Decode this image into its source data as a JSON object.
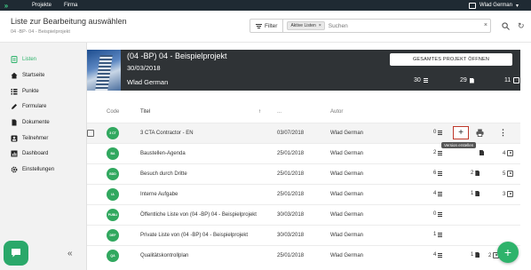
{
  "topbar": {
    "nav": [
      "Projekte",
      "Firma"
    ],
    "user": "Wlad German"
  },
  "header": {
    "title": "Liste zur Bearbeitung auswählen",
    "breadcrumb": "04 -BP- 04 - Beispielprojekt",
    "filter_label": "Filter",
    "chip_label": "Aktive Listen",
    "chip_close": "×",
    "search_placeholder": "Suchen",
    "search_clear": "×"
  },
  "sidebar": {
    "items": [
      {
        "label": "Listen",
        "icon": "list-icon"
      },
      {
        "label": "Startseite",
        "icon": "home-icon"
      },
      {
        "label": "Punkte",
        "icon": "points-icon"
      },
      {
        "label": "Formulare",
        "icon": "pencil-icon"
      },
      {
        "label": "Dokumente",
        "icon": "document-icon"
      },
      {
        "label": "Teilnehmer",
        "icon": "participant-icon"
      },
      {
        "label": "Dashboard",
        "icon": "dashboard-icon"
      },
      {
        "label": "Einstellungen",
        "icon": "gear-icon"
      }
    ],
    "collapse": "«"
  },
  "banner": {
    "name": "(04 -BP) 04 - Beispielprojekt",
    "date": "30/03/2018",
    "manager": "Wlad German",
    "open_button": "GESAMTES PROJEKT ÖFFNEN",
    "stats": {
      "lists": "30",
      "documents": "29",
      "participants": "11"
    }
  },
  "table": {
    "headers": {
      "code": "Code",
      "title": "Titel",
      "sort": "↑",
      "date": "...",
      "author": "Autor"
    },
    "rows": [
      {
        "code": "3 CT",
        "title": "3 CTA Contractor - EN",
        "date": "03/07/2018",
        "author": "Wlad German",
        "points": "0",
        "docs": "",
        "people": ""
      },
      {
        "code": "BA",
        "title": "Baustellen-Agenda",
        "date": "25/01/2018",
        "author": "Wlad German",
        "points": "2",
        "docs": "",
        "people": "4"
      },
      {
        "code": "BDD",
        "title": "Besuch durch Dritte",
        "date": "25/01/2018",
        "author": "Wlad German",
        "points": "6",
        "docs": "2",
        "people": "5"
      },
      {
        "code": "IA",
        "title": "Interne Aufgabe",
        "date": "25/01/2018",
        "author": "Wlad German",
        "points": "4",
        "docs": "1",
        "people": "3"
      },
      {
        "code": "PUBLI",
        "title": "Öffentliche Liste von (04 -BP) 04 - Beispielprojekt",
        "date": "30/03/2018",
        "author": "Wlad German",
        "points": "0",
        "docs": "",
        "people": ""
      },
      {
        "code": "DEF",
        "title": "Private Liste von (04 -BP) 04 - Beispielprojekt",
        "date": "30/03/2018",
        "author": "Wlad German",
        "points": "1",
        "docs": "",
        "people": ""
      },
      {
        "code": "QA",
        "title": "Qualitätskontrollplan",
        "date": "25/01/2018",
        "author": "Wlad German",
        "points": "4",
        "docs": "1",
        "people": "2"
      }
    ]
  },
  "row_actions": {
    "add": "+",
    "tooltip": "Version erstellen",
    "more": "⋮"
  },
  "fab": "+",
  "colors": {
    "accent": "#2eb36b",
    "topbar": "#1f2a33",
    "banner": "#2f3336"
  }
}
